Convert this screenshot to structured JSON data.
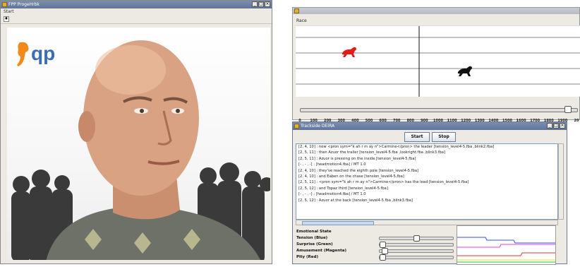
{
  "left_window": {
    "title": "FPP ProgeHrbk",
    "menu": "Start",
    "logo_text": "qp",
    "wbtns": [
      "_",
      "□",
      "×"
    ]
  },
  "race_window": {
    "title": "",
    "label": "Race",
    "ticks": [
      "0",
      "100",
      "200",
      "300",
      "400",
      "500",
      "600",
      "700",
      "800",
      "900",
      "1000",
      "1100",
      "1200",
      "1300",
      "1400",
      "1500",
      "1600",
      "1700",
      "1800",
      "1900",
      "20"
    ],
    "position": 0.96,
    "horses": [
      {
        "name": "red-horse",
        "color": "#e31b1b"
      },
      {
        "name": "black-horse",
        "color": "#111111"
      }
    ]
  },
  "deira_window": {
    "title": "Trackside DEIRA",
    "start_label": "Start",
    "stop_label": "Stop",
    "log_lines": [
      "[2, 4, 10] : now <pron sym=\"k ah r m ay n\">Carmine</pron> the leader [tension_level4-5.fba ,blink2.fba]",
      "[2, 5, 11] : then Azuor the trailer [tension_level4-5.fba ,lookright.fba ,blink3.fba]",
      "[2, 5, 11] : Azuor is pressing on the inside [tension_level4-5.fba]",
      "[- , - , -] : [headmotion4.fba] / MT 1.0",
      "[2, 4, 10] : they've reached the eighth pole [tension_level4-5.fba]",
      "[2, 4, 10] : and Eaben on the chase [tension_level4-5.fba]",
      "[2, 5, 11] : <pron sym=\"k ah r m ay n\">Carmine</pron> has the lead [tension_level4-5.fba]",
      "[2, 5, 12] : and Topaz third [tension_level4-5.fba]",
      "[- , - , -] : [headmotion4.fba] / MT 1.0",
      "[2, 5, 12] : Azuor at the back [tension_level4-5.fba ,blink3.fba]"
    ],
    "emotional_state_label": "Emotional State",
    "emotions": [
      {
        "label": "Tension (Blue)",
        "value": 0.5
      },
      {
        "label": "Surprise (Green)",
        "value": 0.0
      },
      {
        "label": "Amusement (Magenta)",
        "value": 0.04
      },
      {
        "label": "Pity (Red)",
        "value": 0.0
      }
    ],
    "graph_colors": {
      "blue": "#3050ff",
      "green": "#30c040",
      "magenta": "#e040e0",
      "red": "#e03030",
      "yellow": "#e0e030"
    }
  }
}
